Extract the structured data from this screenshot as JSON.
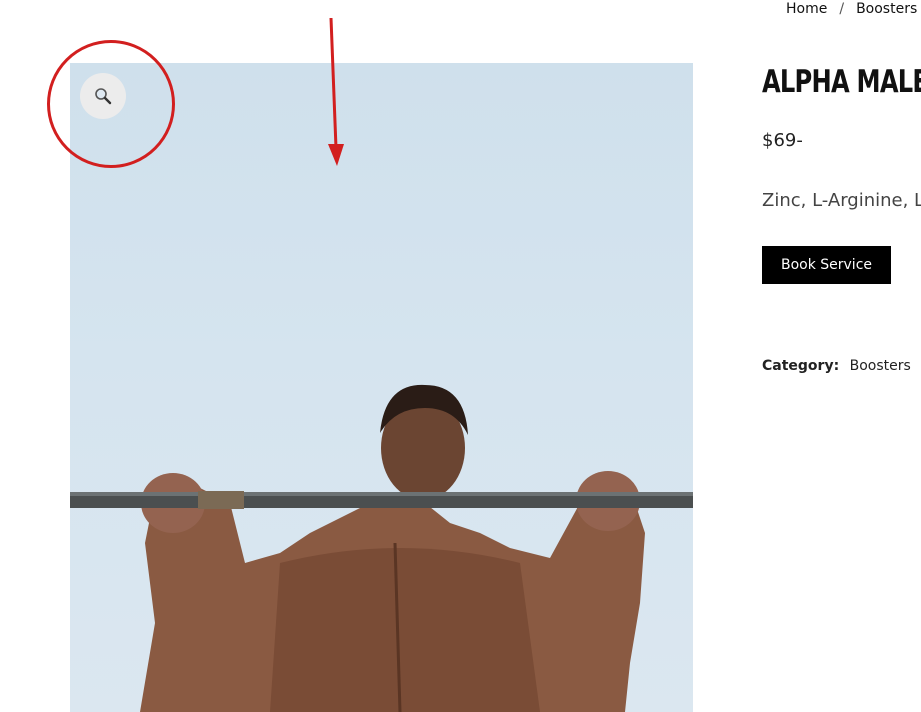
{
  "breadcrumb": {
    "home": "Home",
    "separator": "/",
    "current": "Boosters"
  },
  "product": {
    "title": "ALPHA MALE II",
    "price": "$69-",
    "short_description": "Zinc, L-Arginine, L",
    "book_button": "Book Service",
    "category_label": "Category:",
    "category_value": "Boosters",
    "image_icon": "magnifier-zoom-icon"
  },
  "colors": {
    "annotation": "#d21f1f",
    "button_bg": "#000000",
    "sky": "#d5e4ef"
  }
}
